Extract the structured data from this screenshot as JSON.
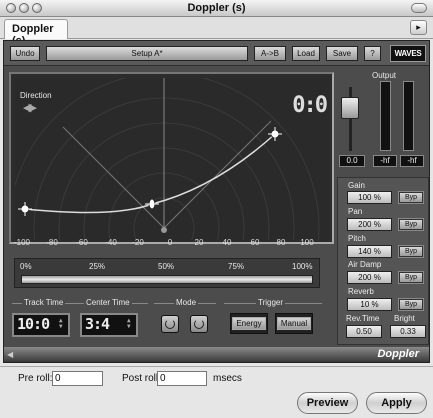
{
  "window": {
    "title": "Doppler (s)"
  },
  "tab": {
    "label": "Doppler (s)",
    "arrow": "▸"
  },
  "toolbar": {
    "undo": "Undo",
    "setup": "Setup A*",
    "ab": "A->B",
    "load": "Load",
    "save": "Save",
    "help": "?",
    "logo": "WAVES"
  },
  "display": {
    "direction_label": "Direction",
    "direction_arrows": "◀▶",
    "counter": "0:0",
    "x_ticks": [
      "-100",
      "-80",
      "-60",
      "-40",
      "-20",
      "0",
      "20",
      "40",
      "60",
      "80",
      "100"
    ]
  },
  "percent_bar": {
    "ticks": [
      "0%",
      "25%",
      "50%",
      "75%",
      "100%"
    ]
  },
  "track_time": {
    "label": "Track Time",
    "value": "10:0"
  },
  "center_time": {
    "label": "Center Time",
    "value": "3:4"
  },
  "mode": {
    "label": "Mode"
  },
  "trigger": {
    "label": "Trigger",
    "energy": "Energy",
    "manual": "Manual"
  },
  "output": {
    "label": "Output",
    "gain_value": "0.0",
    "left_peak": "-hf",
    "right_peak": "-hf",
    "meter_left_level": 0.0,
    "meter_right_level": 0.0
  },
  "params": {
    "gain": {
      "label": "Gain",
      "value": "100 %",
      "byp": "Byp"
    },
    "pan": {
      "label": "Pan",
      "value": "200 %",
      "byp": "Byp"
    },
    "pitch": {
      "label": "Pitch",
      "value": "140 %",
      "byp": "Byp"
    },
    "air_damp": {
      "label": "Air Damp",
      "value": "200 %",
      "byp": "Byp"
    },
    "reverb": {
      "label": "Reverb",
      "value": "10 %",
      "byp": "Byp"
    },
    "rev_time": {
      "label": "Rev.Time",
      "value": "0.50"
    },
    "bright": {
      "label": "Bright",
      "value": "0.33"
    }
  },
  "plugin_footer": {
    "name": "Doppler"
  },
  "bottom": {
    "pre_roll_label": "Pre roll:",
    "pre_roll_value": "0",
    "post_roll_label": "Post roll:",
    "post_roll_value": "0",
    "units": "msecs",
    "preview": "Preview",
    "apply": "Apply"
  }
}
